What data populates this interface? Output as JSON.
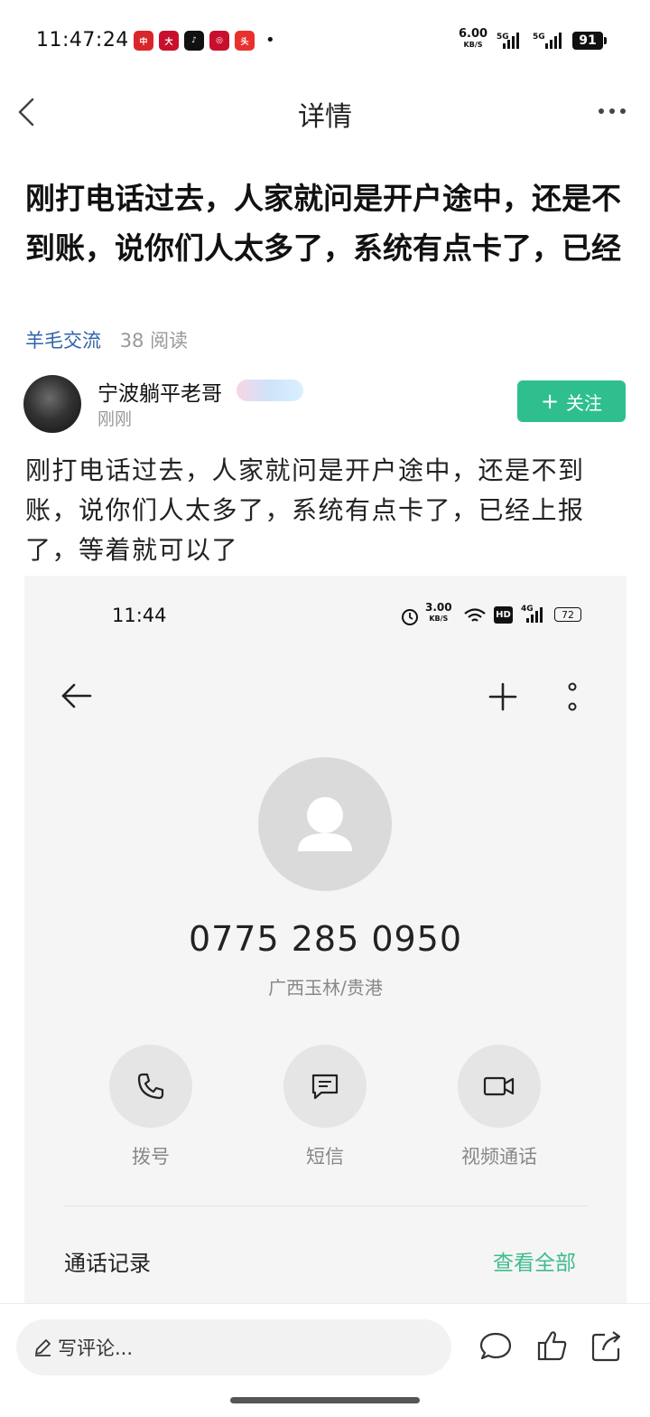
{
  "status_bar": {
    "time": "11:47:24",
    "net_speed_value": "6.00",
    "net_speed_unit": "KB/S",
    "sig1_label": "5G",
    "sig2_label": "5G",
    "battery": "91"
  },
  "header": {
    "title": "详情"
  },
  "article": {
    "title": "刚打电话过去，人家就问是开户途中，还是不到账，说你们人太多了，系统有点卡了，已经",
    "channel": "羊毛交流",
    "reads": "38 阅读",
    "author_name": "宁波躺平老哥",
    "author_time": "刚刚",
    "follow_label": "关注",
    "body": "刚打电话过去，人家就问是开户途中，还是不到账，说你们人太多了，系统有点卡了，已经上报了，等着就可以了"
  },
  "embedded_screenshot": {
    "time": "11:44",
    "net_speed_value": "3.00",
    "net_speed_unit": "KB/S",
    "hd_label": "HD",
    "sig_label": "4G",
    "battery": "72",
    "phone_number": "0775 285 0950",
    "location": "广西玉林/贵港",
    "actions": [
      {
        "label": "拨号",
        "icon": "phone-icon"
      },
      {
        "label": "短信",
        "icon": "message-icon"
      },
      {
        "label": "视频通话",
        "icon": "video-icon"
      }
    ],
    "call_log_label": "通话记录",
    "view_all_label": "查看全部"
  },
  "bottom_bar": {
    "comment_placeholder": "写评论..."
  },
  "colors": {
    "accent_green": "#2fbf8f",
    "link_blue": "#2f63a8",
    "view_all_green": "#3dbd8c"
  }
}
